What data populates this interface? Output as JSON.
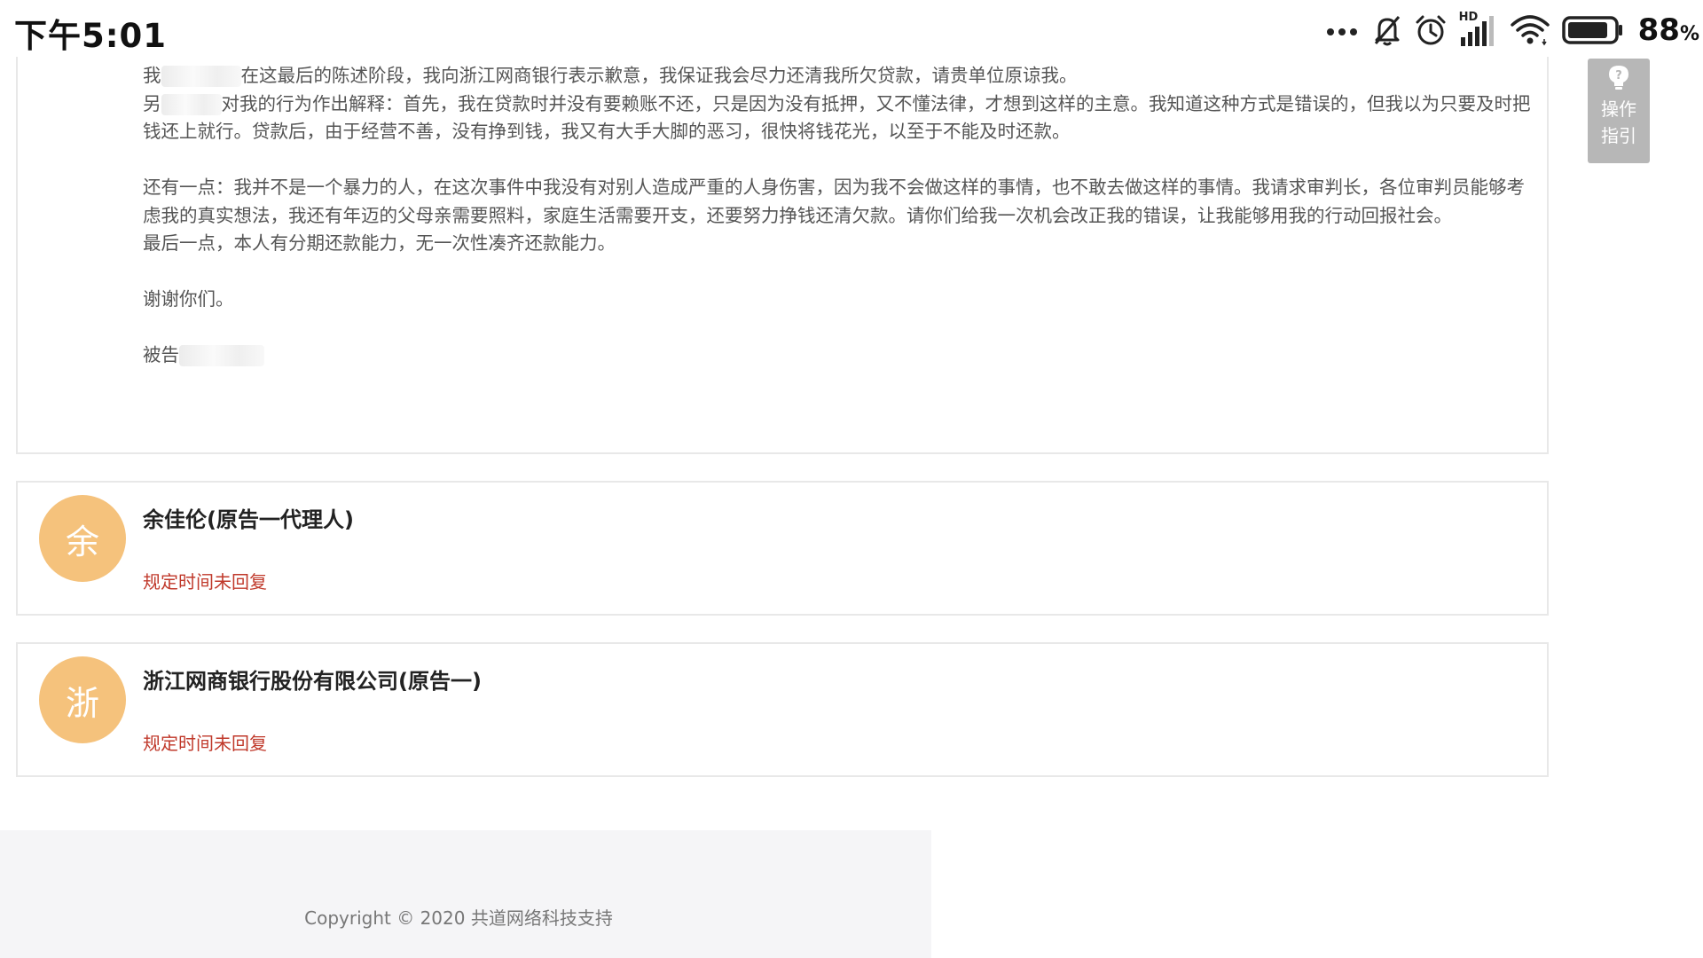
{
  "status_bar": {
    "time": "下午5:01",
    "network_label": "HD",
    "battery_percent": "88",
    "battery_unit": "%",
    "battery_level": 0.88
  },
  "statement": {
    "line1": {
      "prefix": "我",
      "text": "在这最后的陈述阶段，我向浙江网商银行表示歉意，我保证我会尽力还清我所欠贷款，请贵单位原谅我。"
    },
    "line2": {
      "prefix": "另",
      "text": "对我的行为作出解释：首先，我在贷款时并没有要赖账不还，只是因为没有抵押，又不懂法律，才想到这样的主意。我知道这种方式是错误的，但我以为只要及时把钱还上就行。贷款后，由于经营不善，没有挣到钱，我又有大手大脚的恶习，很快将钱花光，以至于不能及时还款。"
    },
    "para2": "还有一点：我并不是一个暴力的人，在这次事件中我没有对别人造成严重的人身伤害，因为我不会做这样的事情，也不敢去做这样的事情。我请求审判长，各位审判员能够考虑我的真实想法，我还有年迈的父母亲需要照料，家庭生活需要开支，还要努力挣钱还清欠款。请你们给我一次机会改正我的错误，让我能够用我的行动回报社会。",
    "para3": "最后一点，本人有分期还款能力，无一次性凑齐还款能力。",
    "thanks": "谢谢你们。",
    "signature_prefix": "被告"
  },
  "replies": [
    {
      "avatar_char": "余",
      "name": "余佳伦(原告一代理人)",
      "status": "规定时间未回复"
    },
    {
      "avatar_char": "浙",
      "name": "浙江网商银行股份有限公司(原告一)",
      "status": "规定时间未回复"
    }
  ],
  "guide_button": {
    "label": "操作指引"
  },
  "footer": {
    "copyright": "Copyright © 2020 共道网络科技支持"
  },
  "colors": {
    "avatar": "#f5c27c",
    "status_red": "#c0392b",
    "guide_bg": "#b7b7b7",
    "footer_bg": "#f5f5f7"
  }
}
